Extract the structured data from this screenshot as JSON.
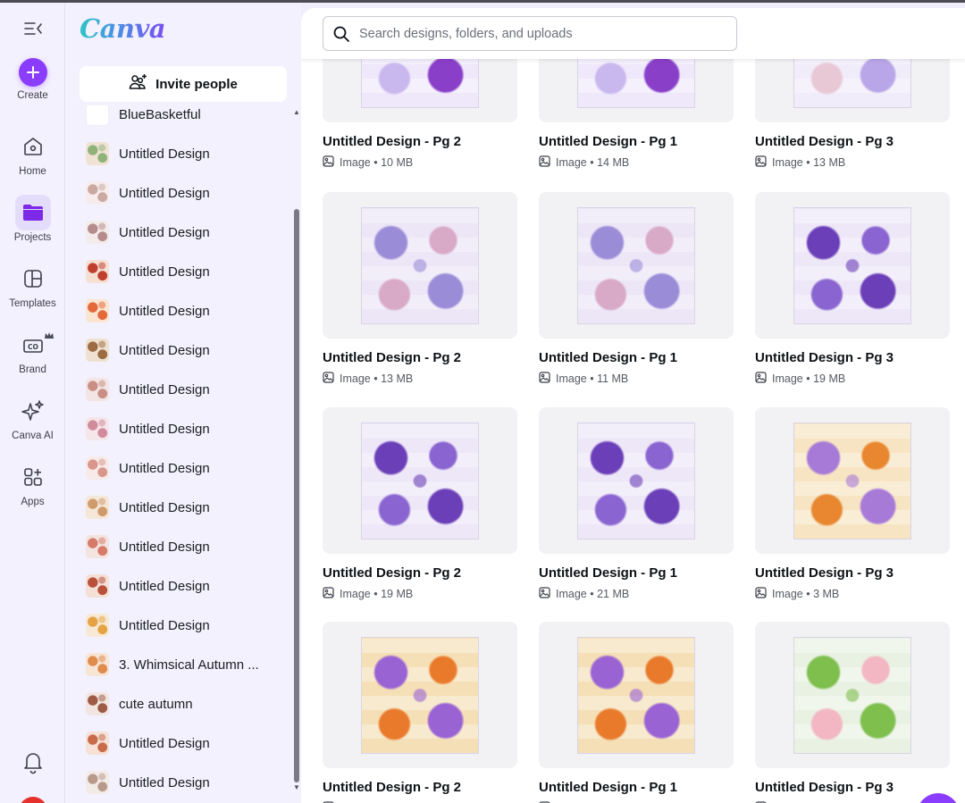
{
  "app": {
    "logo_text": "Canva",
    "brand_color": "#8b3dff"
  },
  "rail": {
    "items": [
      {
        "id": "create",
        "label": "Create",
        "icon": "plus-icon"
      },
      {
        "id": "home",
        "label": "Home",
        "icon": "home-icon"
      },
      {
        "id": "projects",
        "label": "Projects",
        "icon": "folder-icon",
        "active": true
      },
      {
        "id": "templates",
        "label": "Templates",
        "icon": "templates-icon"
      },
      {
        "id": "brand",
        "label": "Brand",
        "icon": "brand-icon",
        "badge": "crown-icon"
      },
      {
        "id": "canva-ai",
        "label": "Canva AI",
        "icon": "sparkle-icon"
      },
      {
        "id": "apps",
        "label": "Apps",
        "icon": "apps-icon"
      }
    ],
    "bottom_icon": "bell-icon"
  },
  "panel": {
    "invite_label": "Invite people",
    "partial_item": "BlueBasketful",
    "items": [
      "Untitled Design",
      "Untitled Design",
      "Untitled Design",
      "Untitled Design",
      "Untitled Design",
      "Untitled Design",
      "Untitled Design",
      "Untitled Design",
      "Untitled Design",
      "Untitled Design",
      "Untitled Design",
      "Untitled Design",
      "Untitled Design",
      "3. Whimsical Autumn ...",
      "cute autumn",
      "Untitled Design",
      "Untitled Design"
    ]
  },
  "search": {
    "placeholder": "Search designs, folders, and uploads",
    "value": ""
  },
  "designs": [
    {
      "title": "Untitled Design - Pg 2",
      "meta": "Image • 10 MB",
      "palette": [
        "#efe8fb",
        "#8a3fc9",
        "#c9b8ee"
      ]
    },
    {
      "title": "Untitled Design - Pg 1",
      "meta": "Image • 14 MB",
      "palette": [
        "#efe8fb",
        "#8a3fc9",
        "#c9b8ee"
      ]
    },
    {
      "title": "Untitled Design - Pg 3",
      "meta": "Image • 13 MB",
      "palette": [
        "#f1ecfa",
        "#b9a6e8",
        "#e9c8d6"
      ]
    },
    {
      "title": "Untitled Design - Pg 2",
      "meta": "Image • 13 MB",
      "palette": [
        "#ece6f6",
        "#9b8cd8",
        "#d9a9c8"
      ]
    },
    {
      "title": "Untitled Design - Pg 1",
      "meta": "Image • 11 MB",
      "palette": [
        "#ece6f6",
        "#9b8cd8",
        "#d9a9c8"
      ]
    },
    {
      "title": "Untitled Design - Pg 3",
      "meta": "Image • 19 MB",
      "palette": [
        "#ede7f8",
        "#6b3fb8",
        "#8a64d0"
      ]
    },
    {
      "title": "Untitled Design - Pg 2",
      "meta": "Image • 19 MB",
      "palette": [
        "#ede7f8",
        "#6b3fb8",
        "#8a64d0"
      ]
    },
    {
      "title": "Untitled Design - Pg 1",
      "meta": "Image • 21 MB",
      "palette": [
        "#ede7f8",
        "#6b3fb8",
        "#8a64d0"
      ]
    },
    {
      "title": "Untitled Design - Pg 3",
      "meta": "Image • 3 MB",
      "palette": [
        "#f7e4c2",
        "#a77ad8",
        "#e8872f"
      ]
    },
    {
      "title": "Untitled Design - Pg 2",
      "meta": "Image • ",
      "palette": [
        "#f5dfb6",
        "#9a63d4",
        "#e97a2c"
      ]
    },
    {
      "title": "Untitled Design - Pg 1",
      "meta": "Image • ",
      "palette": [
        "#f5dfb6",
        "#9a63d4",
        "#e97a2c"
      ]
    },
    {
      "title": "Untitled Design - Pg 3",
      "meta": "Image • ",
      "palette": [
        "#e9f1e3",
        "#7fbf4e",
        "#f2b7c2"
      ]
    }
  ]
}
